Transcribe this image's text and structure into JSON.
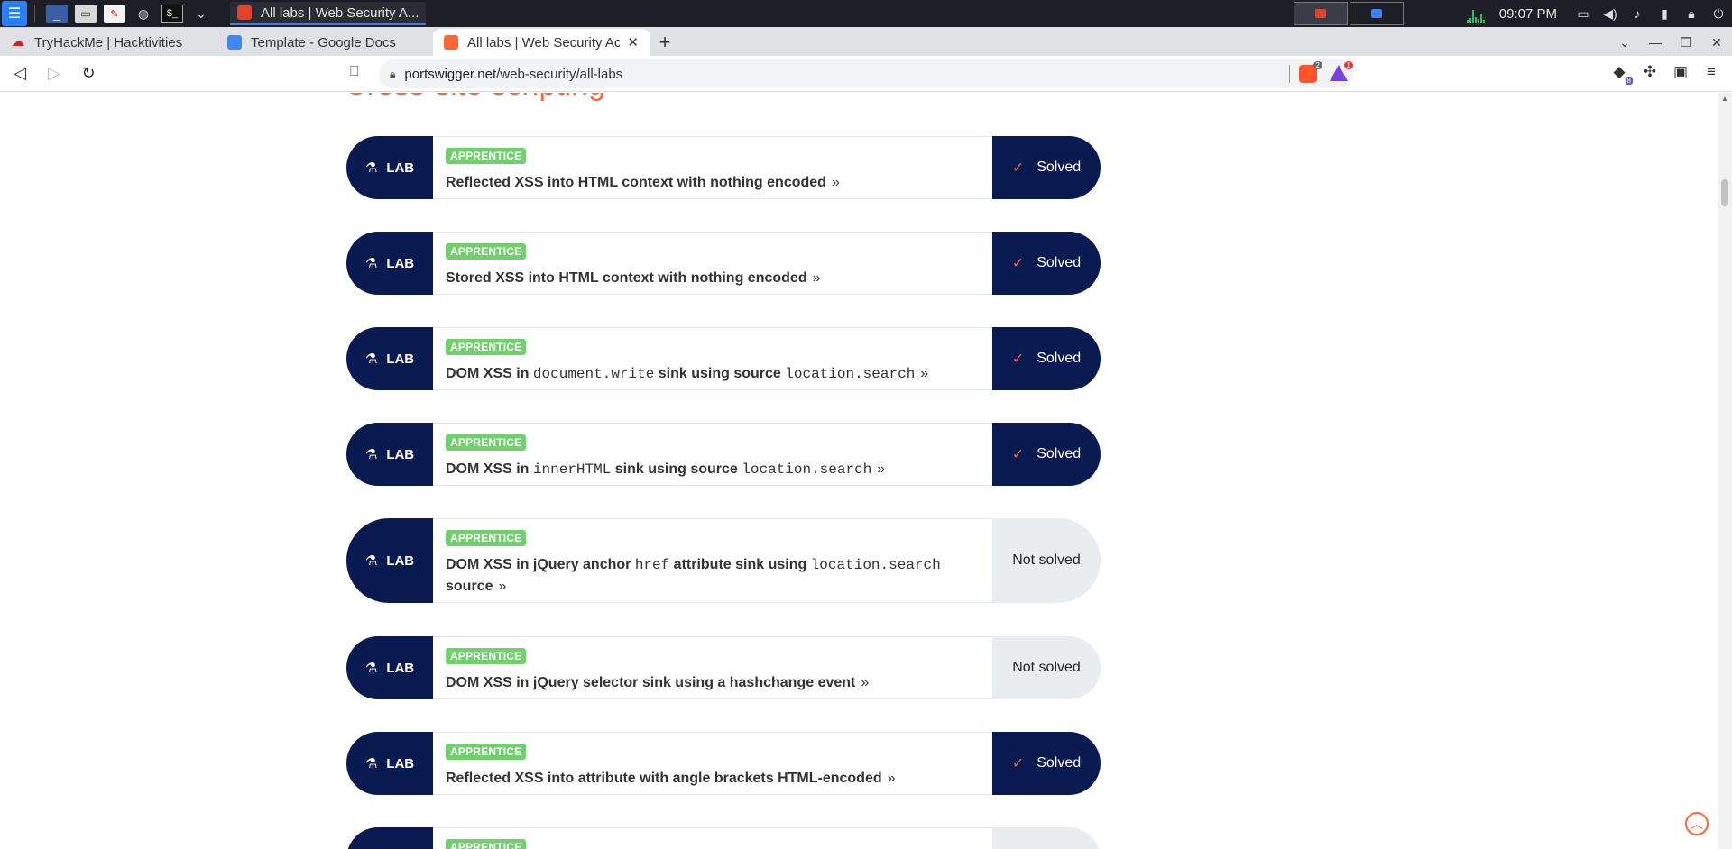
{
  "taskbar": {
    "window_title": "All labs | Web Security A...",
    "clock": "09:07 PM"
  },
  "browser": {
    "tabs": [
      {
        "label": "TryHackMe | Hacktivities",
        "icon": "tryhackme-icon"
      },
      {
        "label": "Template - Google Docs",
        "icon": "google-docs-icon"
      },
      {
        "label": "All labs | Web Security Acad",
        "icon": "portswigger-icon",
        "active": true
      }
    ],
    "url_host": "portswigger.net",
    "url_path": "/web-security/all-labs",
    "shield_count": "2",
    "rewards_count": "1",
    "extensions_count": "8"
  },
  "page": {
    "section_heading": "Cross-site scripting",
    "labs": [
      {
        "tag": "LAB",
        "level": "APPRENTICE",
        "title_parts": [
          {
            "t": "Reflected XSS into HTML context with nothing encoded"
          }
        ],
        "status": "Solved",
        "solved": true
      },
      {
        "tag": "LAB",
        "level": "APPRENTICE",
        "title_parts": [
          {
            "t": "Stored XSS into HTML context with nothing encoded"
          }
        ],
        "status": "Solved",
        "solved": true
      },
      {
        "tag": "LAB",
        "level": "APPRENTICE",
        "title_parts": [
          {
            "t": "DOM XSS in "
          },
          {
            "c": "document.write"
          },
          {
            "t": " sink using source "
          },
          {
            "c": "location.search"
          }
        ],
        "status": "Solved",
        "solved": true
      },
      {
        "tag": "LAB",
        "level": "APPRENTICE",
        "title_parts": [
          {
            "t": "DOM XSS in "
          },
          {
            "c": "innerHTML"
          },
          {
            "t": " sink using source "
          },
          {
            "c": "location.search"
          }
        ],
        "status": "Solved",
        "solved": true
      },
      {
        "tag": "LAB",
        "level": "APPRENTICE",
        "title_parts": [
          {
            "t": "DOM XSS in jQuery anchor "
          },
          {
            "c": "href"
          },
          {
            "t": " attribute sink using "
          },
          {
            "c": "location.search"
          },
          {
            "t": " source"
          }
        ],
        "status": "Not solved",
        "solved": false
      },
      {
        "tag": "LAB",
        "level": "APPRENTICE",
        "title_parts": [
          {
            "t": "DOM XSS in jQuery selector sink using a hashchange event"
          }
        ],
        "status": "Not solved",
        "solved": false
      },
      {
        "tag": "LAB",
        "level": "APPRENTICE",
        "title_parts": [
          {
            "t": "Reflected XSS into attribute with angle brackets HTML-encoded"
          }
        ],
        "status": "Solved",
        "solved": true
      },
      {
        "tag": "LAB",
        "level": "APPRENTICE",
        "title_parts": [
          {
            "t": ""
          }
        ],
        "status": "",
        "solved": false
      }
    ]
  },
  "colors": {
    "brand_orange": "#ff6633",
    "navy": "#0a1b52",
    "apprentice_green": "#70d16c",
    "unsolved_bg": "#e9edf0"
  }
}
